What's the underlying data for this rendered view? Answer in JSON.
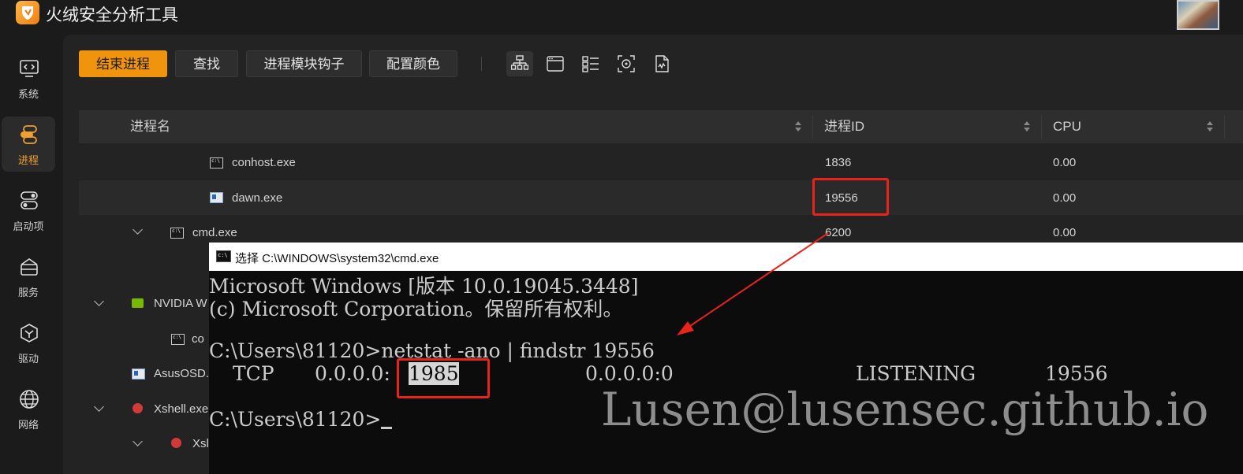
{
  "app": {
    "title": "火绒安全分析工具"
  },
  "sidebar": {
    "items": [
      {
        "label": "系统",
        "icon": "system-code-icon",
        "active": false
      },
      {
        "label": "进程",
        "icon": "process-icon",
        "active": true
      },
      {
        "label": "启动项",
        "icon": "startup-toggle-icon",
        "active": false
      },
      {
        "label": "服务",
        "icon": "service-icon",
        "active": false
      },
      {
        "label": "驱动",
        "icon": "driver-icon",
        "active": false
      },
      {
        "label": "网络",
        "icon": "network-globe-icon",
        "active": false
      }
    ]
  },
  "toolbar": {
    "end_process": "结束进程",
    "find": "查找",
    "module_hooks": "进程模块钩子",
    "config_color": "配置颜色",
    "view_icons": [
      "tree-view-icon",
      "window-view-icon",
      "list-view-icon",
      "target-icon",
      "file-report-icon"
    ]
  },
  "table": {
    "columns": [
      "进程名",
      "进程ID",
      "CPU"
    ],
    "rows": [
      {
        "name": "conhost.exe",
        "pid": "1836",
        "cpu": "0.00",
        "icon": "console"
      },
      {
        "name": "dawn.exe",
        "pid": "19556",
        "cpu": "0.00",
        "icon": "window"
      },
      {
        "name": "cmd.exe",
        "pid": "6200",
        "cpu": "0.00",
        "icon": "console"
      },
      {
        "name": "NVIDIA W",
        "icon": "nvidia"
      },
      {
        "name": "co",
        "icon": "console"
      },
      {
        "name": "AsusOSD.",
        "icon": "window"
      },
      {
        "name": "Xshell.exe",
        "icon": "xshell"
      },
      {
        "name": "Xsl",
        "icon": "xshell"
      }
    ]
  },
  "cmd": {
    "title": "选择 C:\\WINDOWS\\system32\\cmd.exe",
    "line1": "Microsoft Windows [版本 10.0.19045.3448]",
    "line2": "(c) Microsoft Corporation。保留所有权利。",
    "prompt1": "C:\\Users\\81120>netstat -ano | findstr 19556",
    "tcp_proto": "TCP",
    "tcp_local_ip": "0.0.0.0:",
    "tcp_local_port": "1985",
    "tcp_foreign": "0.0.0.0:0",
    "tcp_state": "LISTENING",
    "tcp_pid": "19556",
    "prompt2": "C:\\Users\\81120>"
  },
  "watermark": "Lusen@lusensec.github.io",
  "colors": {
    "accent": "#f0930d",
    "highlight_box": "#e8231c"
  }
}
